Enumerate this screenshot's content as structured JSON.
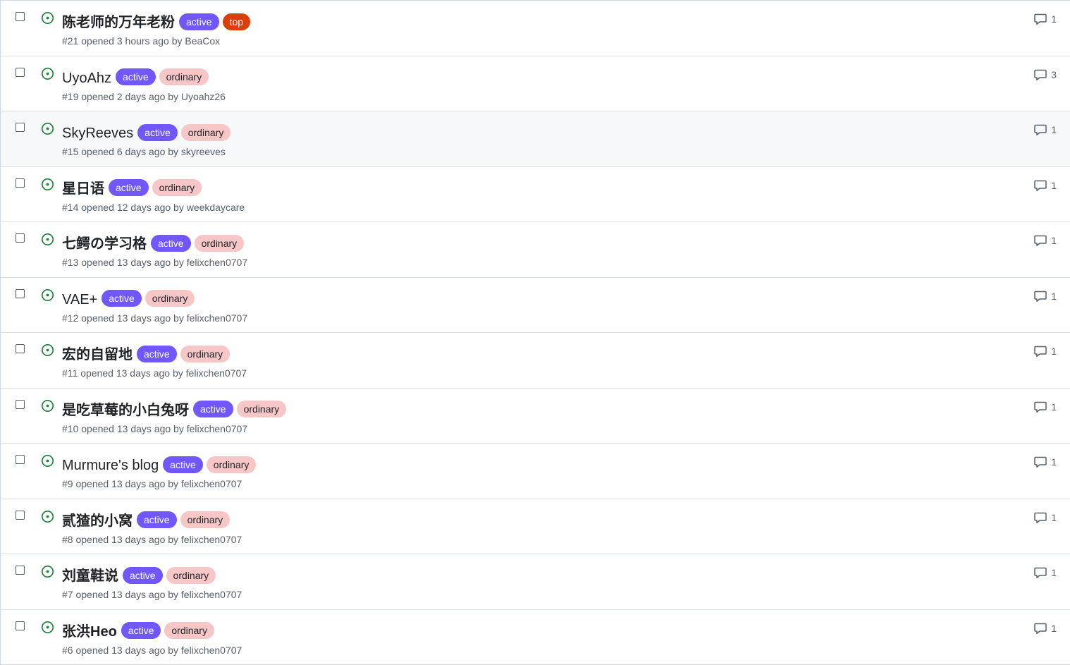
{
  "colors": {
    "open_icon": "#1a7f37",
    "label_active_bg": "#7057ff",
    "label_top_bg": "#d93f0b",
    "label_ordinary_bg": "#f7c6c7",
    "hover_row_bg": "#f6f8fa"
  },
  "icons": {
    "status": "issue-opened-icon",
    "comments": "comment-icon",
    "checkbox": "checkbox-icon"
  },
  "issues": [
    {
      "title": "陈老师的万年老粉",
      "labels": [
        "active",
        "top"
      ],
      "meta": "#21 opened 3 hours ago by BeaCox",
      "comments": "1",
      "cjk": true,
      "hovered": false
    },
    {
      "title": "UyoAhz",
      "labels": [
        "active",
        "ordinary"
      ],
      "meta": "#19 opened 2 days ago by Uyoahz26",
      "comments": "3",
      "cjk": false,
      "hovered": false
    },
    {
      "title": "SkyReeves",
      "labels": [
        "active",
        "ordinary"
      ],
      "meta": "#15 opened 6 days ago by skyreeves",
      "comments": "1",
      "cjk": false,
      "hovered": true
    },
    {
      "title": "星日语",
      "labels": [
        "active",
        "ordinary"
      ],
      "meta": "#14 opened 12 days ago by weekdaycare",
      "comments": "1",
      "cjk": true,
      "hovered": false
    },
    {
      "title": "七鳄の学习格",
      "labels": [
        "active",
        "ordinary"
      ],
      "meta": "#13 opened 13 days ago by felixchen0707",
      "comments": "1",
      "cjk": true,
      "hovered": false
    },
    {
      "title": "VAE+",
      "labels": [
        "active",
        "ordinary"
      ],
      "meta": "#12 opened 13 days ago by felixchen0707",
      "comments": "1",
      "cjk": false,
      "hovered": false
    },
    {
      "title": "宏的自留地",
      "labels": [
        "active",
        "ordinary"
      ],
      "meta": "#11 opened 13 days ago by felixchen0707",
      "comments": "1",
      "cjk": true,
      "hovered": false
    },
    {
      "title": "是吃草莓的小白兔呀",
      "labels": [
        "active",
        "ordinary"
      ],
      "meta": "#10 opened 13 days ago by felixchen0707",
      "comments": "1",
      "cjk": true,
      "hovered": false
    },
    {
      "title": "Murmure's blog",
      "labels": [
        "active",
        "ordinary"
      ],
      "meta": "#9 opened 13 days ago by felixchen0707",
      "comments": "1",
      "cjk": false,
      "hovered": false
    },
    {
      "title": "贰猹的小窝",
      "labels": [
        "active",
        "ordinary"
      ],
      "meta": "#8 opened 13 days ago by felixchen0707",
      "comments": "1",
      "cjk": true,
      "hovered": false
    },
    {
      "title": "刘童鞋说",
      "labels": [
        "active",
        "ordinary"
      ],
      "meta": "#7 opened 13 days ago by felixchen0707",
      "comments": "1",
      "cjk": true,
      "hovered": false
    },
    {
      "title": "张洪Heo",
      "labels": [
        "active",
        "ordinary"
      ],
      "meta": "#6 opened 13 days ago by felixchen0707",
      "comments": "1",
      "cjk": true,
      "hovered": false
    }
  ]
}
